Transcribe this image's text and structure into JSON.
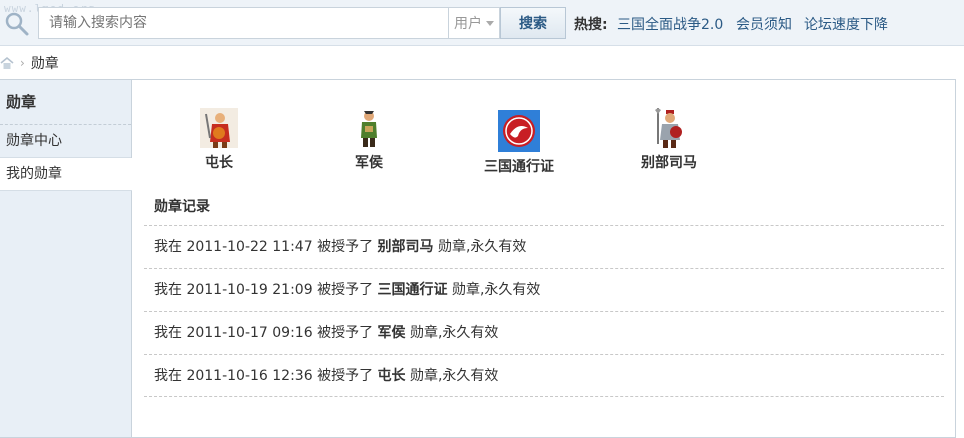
{
  "watermark": "www.lmod.org",
  "search": {
    "placeholder": "请输入搜索内容",
    "type": "用户",
    "button": "搜索"
  },
  "hot": {
    "label": "热搜:",
    "links": [
      "三国全面战争2.0",
      "会员须知",
      "论坛速度下降"
    ]
  },
  "breadcrumb": {
    "separator": "›",
    "current": "勋章"
  },
  "sidebar": {
    "title": "勋章",
    "items": [
      {
        "label": "勋章中心",
        "active": false
      },
      {
        "label": "我的勋章",
        "active": true
      }
    ]
  },
  "badges": [
    {
      "name": "屯长",
      "icon": "warrior-red-icon"
    },
    {
      "name": "军侯",
      "icon": "soldier-green-icon"
    },
    {
      "name": "三国通行证",
      "icon": "blue-emblem-icon"
    },
    {
      "name": "别部司马",
      "icon": "knight-red-icon"
    }
  ],
  "records": {
    "title": "勋章记录",
    "items": [
      {
        "prefix": "我在 ",
        "time": "2011-10-22 11:47",
        "mid": " 被授予了 ",
        "badge": "别部司马",
        "suffix": " 勋章,永久有效"
      },
      {
        "prefix": "我在 ",
        "time": "2011-10-19 21:09",
        "mid": " 被授予了 ",
        "badge": "三国通行证",
        "suffix": " 勋章,永久有效"
      },
      {
        "prefix": "我在 ",
        "time": "2011-10-17 09:16",
        "mid": " 被授予了 ",
        "badge": "军侯",
        "suffix": " 勋章,永久有效"
      },
      {
        "prefix": "我在 ",
        "time": "2011-10-16 12:36",
        "mid": " 被授予了 ",
        "badge": "屯长",
        "suffix": " 勋章,永久有效"
      }
    ]
  }
}
